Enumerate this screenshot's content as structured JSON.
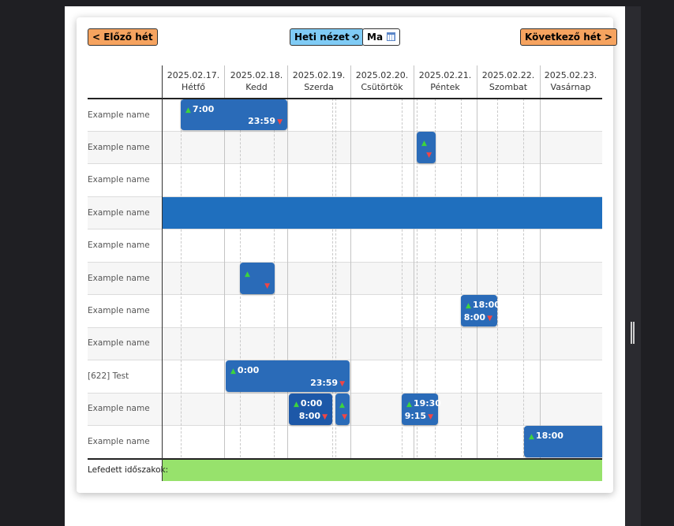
{
  "nav": {
    "prev_label": "< Előző hét",
    "week_view_label": "Heti nézet",
    "today_label": "Ma",
    "next_label": "Következő hét >"
  },
  "days": [
    {
      "date": "2025.02.17.",
      "name": "Hétfő"
    },
    {
      "date": "2025.02.18.",
      "name": "Kedd"
    },
    {
      "date": "2025.02.19.",
      "name": "Szerda"
    },
    {
      "date": "2025.02.20.",
      "name": "Csütörtök"
    },
    {
      "date": "2025.02.21.",
      "name": "Péntek"
    },
    {
      "date": "2025.02.22.",
      "name": "Szombat"
    },
    {
      "date": "2025.02.23.",
      "name": "Vasárnap"
    }
  ],
  "rows": [
    {
      "label": "Example name"
    },
    {
      "label": "Example name"
    },
    {
      "label": "Example name"
    },
    {
      "label": "Example name"
    },
    {
      "label": "Example name"
    },
    {
      "label": "Example name"
    },
    {
      "label": "Example name"
    },
    {
      "label": "Example name"
    },
    {
      "label": "[622] Test"
    },
    {
      "label": "Example name"
    },
    {
      "label": "Example name"
    }
  ],
  "events": [
    {
      "start": "7:00",
      "end": "23:59"
    },
    {
      "start": "",
      "end": ""
    },
    {
      "start": "",
      "end": ""
    },
    {
      "start": "18:00",
      "end": "8:00"
    },
    {
      "start": "0:00",
      "end": "23:59"
    },
    {
      "start": "0:00",
      "end": "8:00"
    },
    {
      "start": "",
      "end": ""
    },
    {
      "start": "19:30",
      "end": "9:15"
    },
    {
      "start": "18:00",
      "end": ""
    }
  ],
  "footer": {
    "covered_label": "Lefedett időszakok:"
  },
  "colors": {
    "event": "#2a6bb8",
    "covered": "#97e26c",
    "nav_orange": "#f6a35f",
    "nav_blue": "#7fcbf5"
  }
}
